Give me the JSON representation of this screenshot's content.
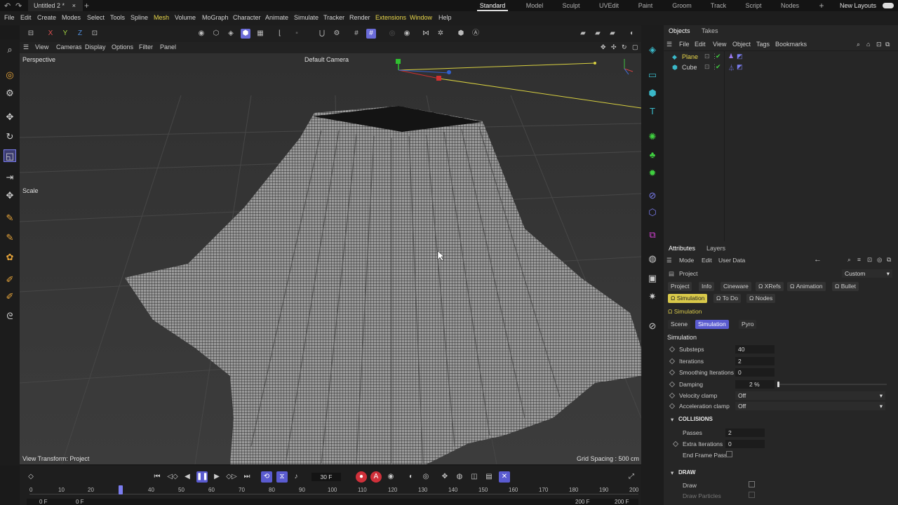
{
  "titlebar": {
    "tab_title": "Untitled 2 *",
    "layouts": [
      "Standard",
      "Model",
      "Sculpt",
      "UVEdit",
      "Paint",
      "Groom",
      "Track",
      "Script",
      "Nodes"
    ],
    "new_layouts": "New Layouts"
  },
  "menu": [
    "File",
    "Edit",
    "Create",
    "Modes",
    "Select",
    "Tools",
    "Spline",
    "Mesh",
    "Volume",
    "MoGraph",
    "Character",
    "Animate",
    "Simulate",
    "Tracker",
    "Render",
    "Extensions",
    "Window",
    "Help"
  ],
  "toolbar": {
    "axis_x": "X",
    "axis_y": "Y",
    "axis_z": "Z"
  },
  "viewport_menu": [
    "View",
    "Cameras",
    "Display",
    "Options",
    "Filter",
    "Panel"
  ],
  "viewport": {
    "perspective": "Perspective",
    "camera": "Default Camera",
    "scale_label": "Scale",
    "view_transform": "View Transform: Project",
    "grid_spacing": "Grid Spacing : 500 cm"
  },
  "objects_panel": {
    "tabs": [
      "Objects",
      "Takes"
    ],
    "menu": [
      "File",
      "Edit",
      "View",
      "Object",
      "Tags",
      "Bookmarks"
    ],
    "items": [
      {
        "name": "Plane"
      },
      {
        "name": "Cube"
      }
    ]
  },
  "attributes_panel": {
    "tabs": [
      "Attributes",
      "Layers"
    ],
    "menu": [
      "Mode",
      "Edit",
      "User Data"
    ],
    "project_label": "Project",
    "custom_select": "Custom",
    "tabs_row1": [
      "Project",
      "Info",
      "Cineware",
      "XRefs",
      "Animation",
      "Bullet"
    ],
    "tabs_row2": [
      "Simulation",
      "To Do",
      "Nodes"
    ],
    "section_title": "Simulation",
    "subtabs": [
      "Scene",
      "Simulation",
      "Pyro"
    ],
    "group_title": "Simulation",
    "fields": [
      {
        "label": "Substeps",
        "value": "40"
      },
      {
        "label": "Iterations",
        "value": "2"
      },
      {
        "label": "Smoothing Iterations",
        "value": "0"
      },
      {
        "label": "Damping",
        "value": "2 %"
      },
      {
        "label": "Velocity clamp",
        "value": "Off"
      },
      {
        "label": "Acceleration clamp",
        "value": "Off"
      }
    ],
    "collisions_title": "COLLISIONS",
    "collision_fields": [
      {
        "label": "Passes",
        "value": "2"
      },
      {
        "label": "Extra Iterations",
        "value": "0"
      },
      {
        "label": "End Frame Pass",
        "value": ""
      }
    ],
    "draw_title": "DRAW",
    "draw_fields": [
      {
        "label": "Draw"
      },
      {
        "label": "Draw Particles"
      }
    ]
  },
  "timeline": {
    "current_frame": "30 F",
    "ticks": [
      "0",
      "10",
      "20",
      "40",
      "50",
      "60",
      "70",
      "80",
      "90",
      "100",
      "110",
      "120",
      "130",
      "140",
      "150",
      "160",
      "170",
      "180",
      "190",
      "200"
    ],
    "start": "0 F",
    "start2": "0 F",
    "end": "200 F",
    "end2": "200 F"
  },
  "colors": {
    "accent_yellow": "#d9c94a",
    "accent_blue": "#5a5bd0",
    "check_green": "#40d040",
    "icon_teal": "#3ab8c8"
  }
}
